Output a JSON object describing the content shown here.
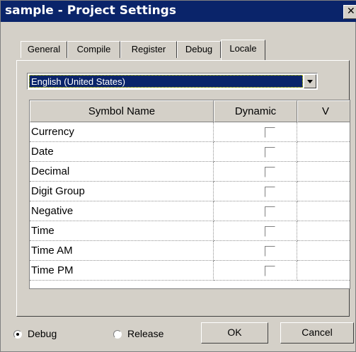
{
  "window": {
    "title": "sample - Project Settings",
    "close_glyph": "✕"
  },
  "tabs": [
    {
      "label": "General"
    },
    {
      "label": "Compile"
    },
    {
      "label": "Register"
    },
    {
      "label": "Debug"
    },
    {
      "label": "Locale",
      "active": true
    }
  ],
  "locale_select": {
    "value": "English (United States)"
  },
  "grid": {
    "columns": [
      "Symbol Name",
      "Dynamic",
      "V"
    ],
    "rows": [
      {
        "name": "Currency",
        "dynamic": false
      },
      {
        "name": "Date",
        "dynamic": false
      },
      {
        "name": "Decimal",
        "dynamic": false
      },
      {
        "name": "Digit Group",
        "dynamic": false
      },
      {
        "name": "Negative",
        "dynamic": false
      },
      {
        "name": "Time",
        "dynamic": false
      },
      {
        "name": "Time AM",
        "dynamic": false
      },
      {
        "name": "Time PM",
        "dynamic": false
      }
    ]
  },
  "footer": {
    "radio_debug": {
      "label": "Debug",
      "selected": true
    },
    "radio_release": {
      "label": "Release",
      "selected": false
    },
    "ok_label": "OK",
    "cancel_label": "Cancel"
  }
}
